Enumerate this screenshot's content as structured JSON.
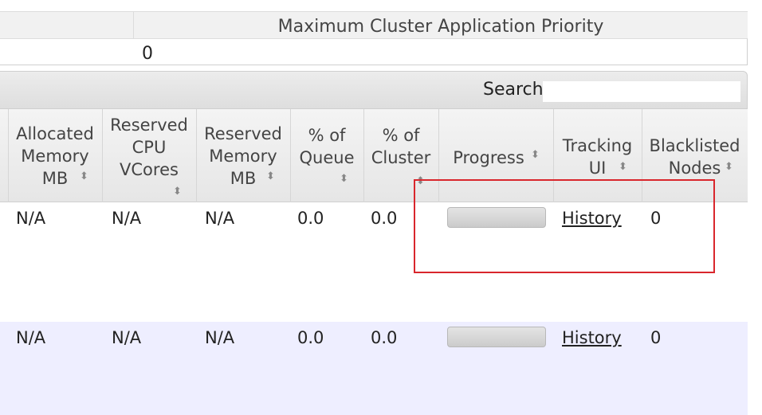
{
  "summary": {
    "column_header": "Maximum Cluster Application Priority",
    "value": "0"
  },
  "search": {
    "label": "Search:",
    "value": ""
  },
  "columns": [
    {
      "label": "Allocated\nMemory\nMB"
    },
    {
      "label": "Reserved\nCPU\nVCores"
    },
    {
      "label": "Reserved\nMemory\nMB"
    },
    {
      "label": "% of\nQueue"
    },
    {
      "label": "% of\nCluster"
    },
    {
      "label": "Progress"
    },
    {
      "label": "Tracking\nUI"
    },
    {
      "label": "Blacklisted\nNodes"
    }
  ],
  "sort_icon": "sort-both-icon",
  "rows": [
    {
      "allocated_memory_mb": "N/A",
      "reserved_cpu_vcores": "N/A",
      "reserved_memory_mb": "N/A",
      "pct_queue": "0.0",
      "pct_cluster": "0.0",
      "progress_percent": 0,
      "tracking_ui": "History",
      "blacklisted_nodes": "0"
    },
    {
      "allocated_memory_mb": "N/A",
      "reserved_cpu_vcores": "N/A",
      "reserved_memory_mb": "N/A",
      "pct_queue": "0.0",
      "pct_cluster": "0.0",
      "progress_percent": 0,
      "tracking_ui": "History",
      "blacklisted_nodes": "0"
    }
  ],
  "colors": {
    "annotation_box": "#d9262c",
    "row_alt": "#eeeeff"
  }
}
